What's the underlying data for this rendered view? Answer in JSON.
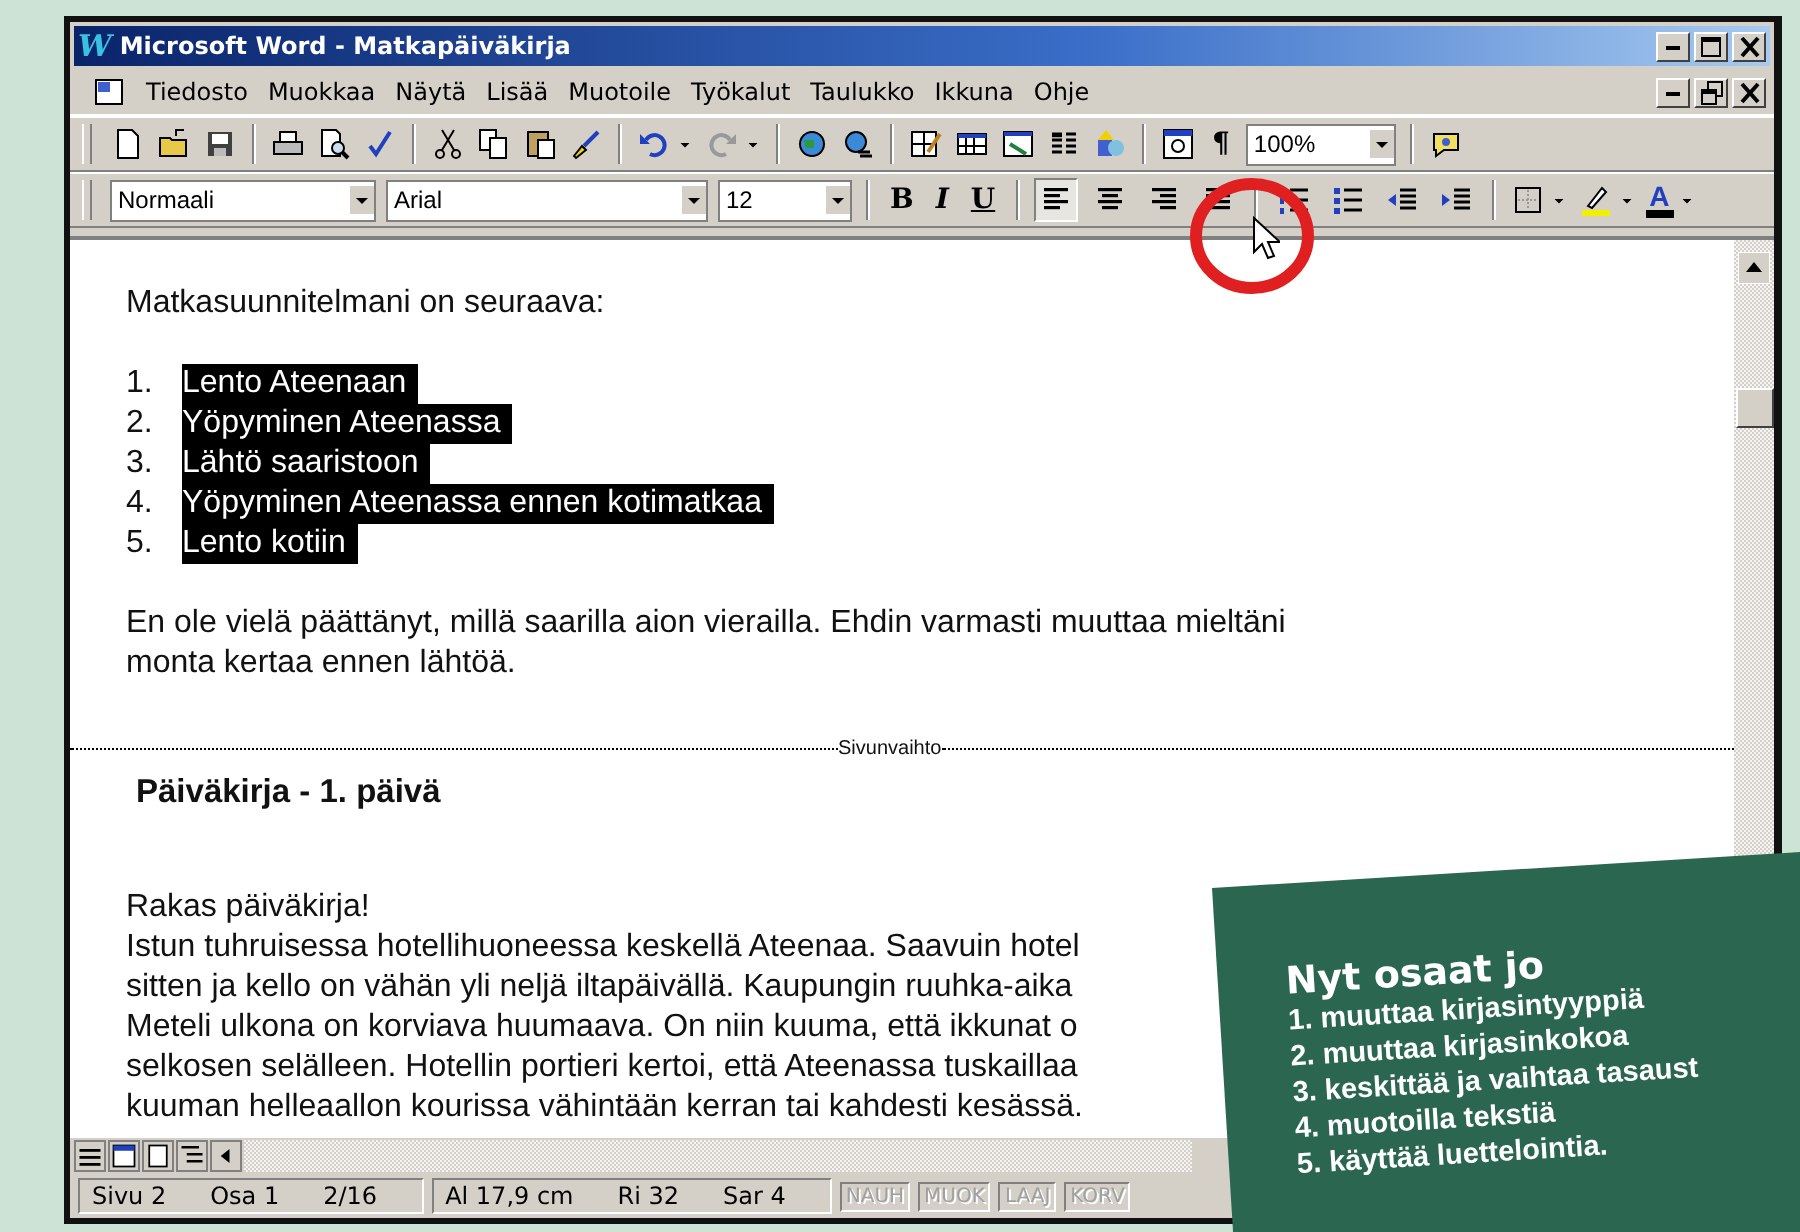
{
  "window": {
    "icon_text": "W",
    "title": "Microsoft Word - Matkapäiväkirja",
    "controls": [
      {
        "kind": "minimize"
      },
      {
        "kind": "maximize"
      },
      {
        "kind": "close"
      }
    ]
  },
  "menu_bar": {
    "items": [
      {
        "label": "Tiedosto"
      },
      {
        "label": "Muokkaa"
      },
      {
        "label": "Näytä"
      },
      {
        "label": "Lisää"
      },
      {
        "label": "Muotoile"
      },
      {
        "label": "Työkalut"
      },
      {
        "label": "Taulukko"
      },
      {
        "label": "Ikkuna"
      },
      {
        "label": "Ohje"
      }
    ],
    "controls": [
      {
        "kind": "minimize"
      },
      {
        "kind": "restore"
      },
      {
        "kind": "close"
      }
    ]
  },
  "standard_toolbar": [
    {
      "kind": "new"
    },
    {
      "kind": "open"
    },
    {
      "kind": "save"
    },
    {
      "kind": "sep"
    },
    {
      "kind": "print"
    },
    {
      "kind": "preview"
    },
    {
      "kind": "spell"
    },
    {
      "kind": "sep"
    },
    {
      "kind": "cut"
    },
    {
      "kind": "copy"
    },
    {
      "kind": "paste"
    },
    {
      "kind": "brush"
    },
    {
      "kind": "sep"
    },
    {
      "kind": "undo"
    },
    {
      "kind": "caret"
    },
    {
      "kind": "redo"
    },
    {
      "kind": "caret"
    },
    {
      "kind": "sep"
    },
    {
      "kind": "web"
    },
    {
      "kind": "link"
    },
    {
      "kind": "sep"
    },
    {
      "kind": "tablepen"
    },
    {
      "kind": "table"
    },
    {
      "kind": "sheet"
    },
    {
      "kind": "columns"
    },
    {
      "kind": "shapes"
    },
    {
      "kind": "sep"
    },
    {
      "kind": "docmap"
    },
    {
      "kind": "char",
      "label": "¶"
    },
    {
      "kind": "combo",
      "value": "100%"
    },
    {
      "kind": "sep"
    },
    {
      "kind": "help"
    }
  ],
  "formatting_toolbar": [
    {
      "kind": "style-combo",
      "value": "Normaali"
    },
    {
      "kind": "font-combo",
      "value": "Arial"
    },
    {
      "kind": "size-combo",
      "value": "12"
    },
    {
      "kind": "sep"
    },
    {
      "kind": "bold",
      "label": "B"
    },
    {
      "kind": "italic",
      "label": "I"
    },
    {
      "kind": "underline",
      "label": "U"
    },
    {
      "kind": "sep"
    },
    {
      "kind": "align-left",
      "selected": true
    },
    {
      "kind": "align-center",
      "selected": false
    },
    {
      "kind": "align-right",
      "selected": false
    },
    {
      "kind": "justify",
      "selected": false
    },
    {
      "kind": "sep"
    },
    {
      "kind": "numbered-list",
      "selected": false
    },
    {
      "kind": "bulleted-list",
      "selected": false
    },
    {
      "kind": "outdent",
      "selected": false
    },
    {
      "kind": "indent",
      "selected": false
    },
    {
      "kind": "sep"
    },
    {
      "kind": "border"
    },
    {
      "kind": "caret"
    },
    {
      "kind": "highlighter"
    },
    {
      "kind": "caret"
    },
    {
      "kind": "fontcolor",
      "label": "A"
    },
    {
      "kind": "caret"
    }
  ],
  "document": {
    "intro": "Matkasuunnitelmani on seuraava:",
    "list": [
      {
        "number": "1.",
        "text": "Lento Ateenaan",
        "selected": true
      },
      {
        "number": "2.",
        "text": "Yöpyminen Ateenassa",
        "selected": true
      },
      {
        "number": "3.",
        "text": "Lähtö saaristoon",
        "selected": true
      },
      {
        "number": "4.",
        "text": "Yöpyminen Ateenassa ennen kotimatkaa",
        "selected": true
      },
      {
        "number": "5.",
        "text": "Lento kotiin",
        "selected": true
      }
    ],
    "paragraph_lines": [
      "En ole vielä päättänyt, millä saarilla aion vierailla. Ehdin varmasti muuttaa mieltäni",
      "monta kertaa ennen lähtöä."
    ],
    "page_break": "Sivunvaihto",
    "heading": "Päiväkirja - 1. päivä",
    "diary_lines": [
      "Rakas päiväkirja!",
      "Istun tuhruisessa hotellihuoneessa keskellä Ateenaa. Saavuin hotel",
      "sitten ja kello on vähän yli neljä iltapäivällä. Kaupungin ruuhka-aika",
      "Meteli ulkona on korviava huumaava. On niin kuuma, että ikkunat o",
      "selkosen selälleen. Hotellin portieri kertoi, että Ateenassa tuskaillaa",
      "kuuman helleaallon kourissa vähintään kerran tai kahdesti kesässä."
    ]
  },
  "view_buttons": [
    {
      "kind": "normal"
    },
    {
      "kind": "web"
    },
    {
      "kind": "layout"
    },
    {
      "kind": "outline"
    }
  ],
  "status_bar": {
    "panels": [
      {
        "fields": [
          "Sivu 2",
          "Osa 1",
          "2/16"
        ]
      },
      {
        "fields": [
          "Al 17,9 cm",
          "Ri 32",
          "Sar 4"
        ]
      }
    ],
    "indicators": [
      {
        "label": "NAUH",
        "active": false
      },
      {
        "label": "MUOK",
        "active": false
      },
      {
        "label": "LAAJ",
        "active": false
      },
      {
        "label": "KORV",
        "active": false
      }
    ]
  },
  "summary_card": {
    "title": "Nyt osaat jo",
    "items": [
      {
        "number": "1.",
        "text": "muuttaa kirjasintyyppiä"
      },
      {
        "number": "2.",
        "text": "muuttaa kirjasinkokoa"
      },
      {
        "number": "3.",
        "text": "keskittää ja vaihtaa tasaust"
      },
      {
        "number": "4.",
        "text": "muotoilla tekstiä"
      },
      {
        "number": "5.",
        "text": "käyttää luettelointia."
      }
    ]
  }
}
